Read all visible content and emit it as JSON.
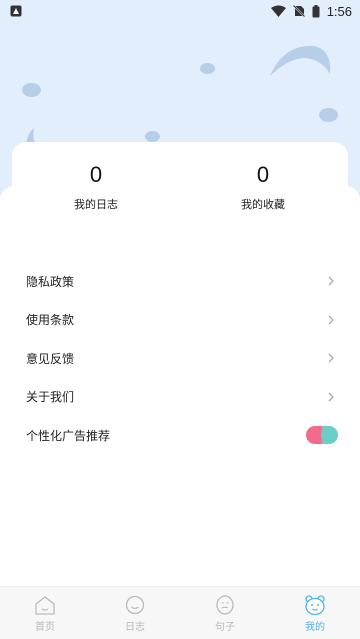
{
  "status_bar": {
    "time": "1:56"
  },
  "stats": [
    {
      "count": "0",
      "label": "我的日志"
    },
    {
      "count": "0",
      "label": "我的收藏"
    }
  ],
  "menu": [
    {
      "label": "隐私政策"
    },
    {
      "label": "使用条款"
    },
    {
      "label": "意见反馈"
    },
    {
      "label": "关于我们"
    }
  ],
  "ad_toggle": {
    "label": "个性化广告推荐",
    "enabled": true
  },
  "tabs": [
    {
      "label": "首页",
      "icon": "home-icon"
    },
    {
      "label": "日志",
      "icon": "diary-icon"
    },
    {
      "label": "句子",
      "icon": "sentence-icon"
    },
    {
      "label": "我的",
      "icon": "profile-icon",
      "active": true
    }
  ],
  "colors": {
    "header_bg": "#e3eefc",
    "accent": "#4fb6e8",
    "toggle_pink": "#f26b8a",
    "toggle_teal": "#6ed0c8"
  }
}
